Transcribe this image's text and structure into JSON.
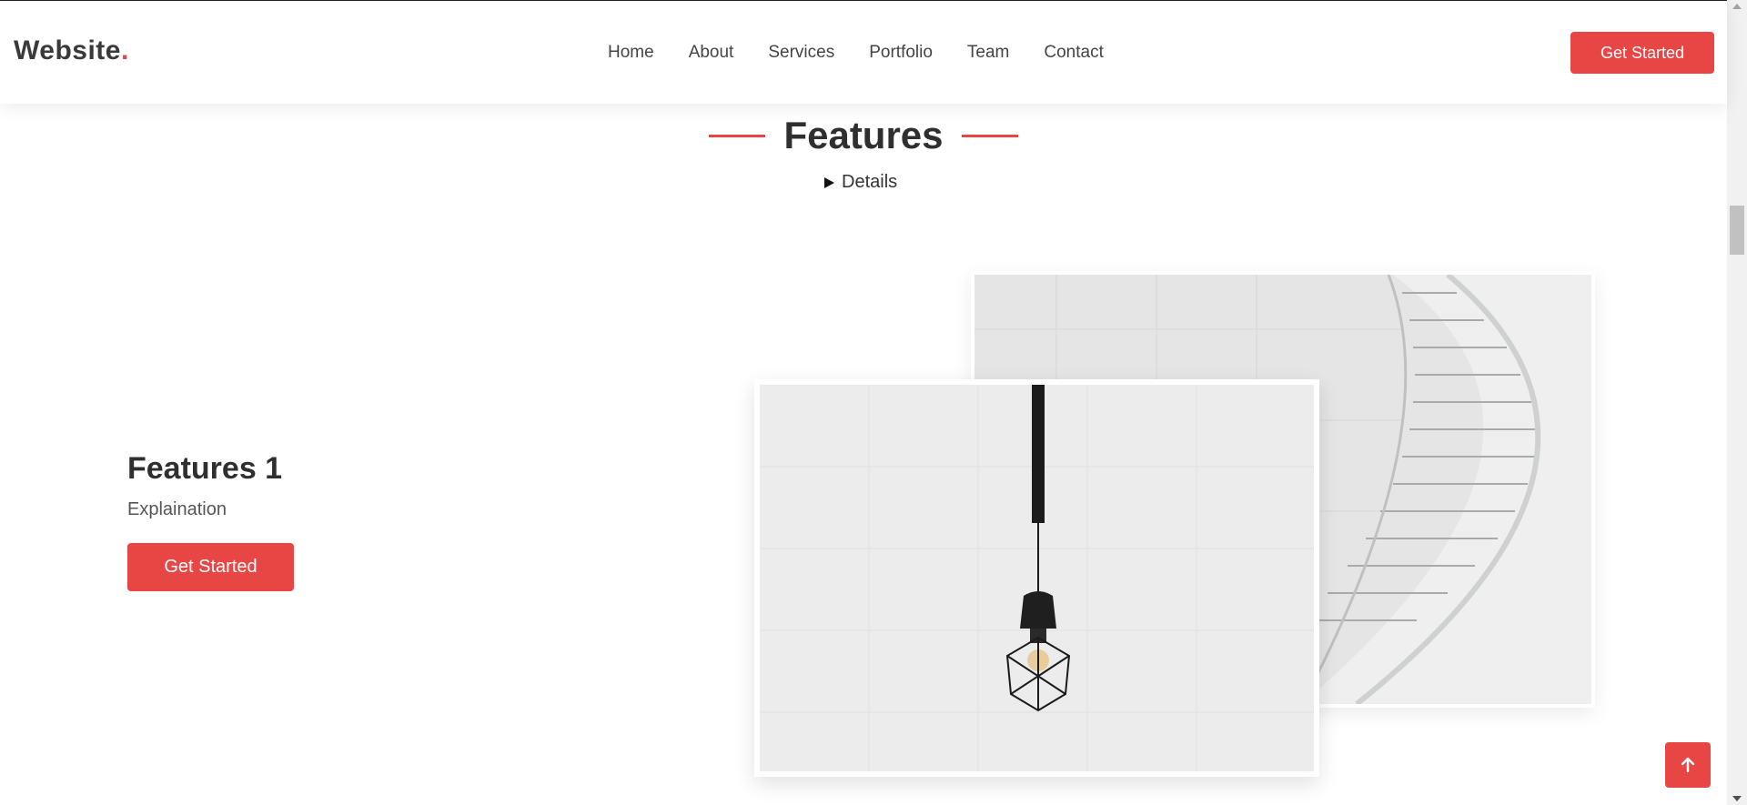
{
  "header": {
    "logo_text": "Website",
    "logo_dot": ".",
    "nav": [
      "Home",
      "About",
      "Services",
      "Portfolio",
      "Team",
      "Contact"
    ],
    "cta_label": "Get Started"
  },
  "section": {
    "title": "Features",
    "details_label": "Details"
  },
  "feature": {
    "title": "Features 1",
    "text": "Explaination",
    "cta_label": "Get Started"
  },
  "icons": {
    "back_to_top": "arrow-up-icon",
    "details": "triangle-right-icon"
  },
  "colors": {
    "accent": "#e84545",
    "heading": "#2f2f2f"
  }
}
